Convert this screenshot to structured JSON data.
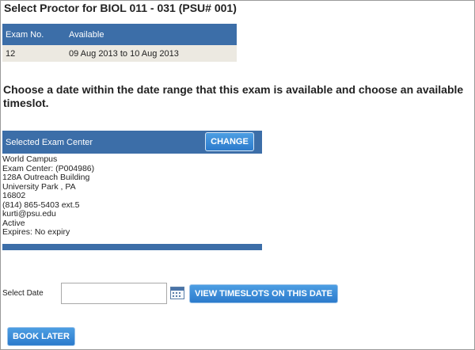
{
  "page": {
    "title": "Select Proctor for BIOL 011 - 031 (PSU# 001)"
  },
  "exam_table": {
    "headers": [
      "Exam No.",
      "Available"
    ],
    "rows": [
      [
        "12",
        "09 Aug 2013 to 10 Aug 2013"
      ]
    ]
  },
  "instruction": "Choose a date within the date range that this exam is available and choose an available timeslot.",
  "exam_center": {
    "header_label": "Selected Exam Center",
    "change_button": "CHANGE",
    "details": [
      "World Campus",
      "Exam Center: (P004986)",
      "128A Outreach Building",
      "University Park , PA",
      "16802",
      "(814) 865-5403 ext.5",
      "kurti@psu.edu",
      "Active",
      "Expires: No expiry"
    ]
  },
  "date_select": {
    "label": "Select Date",
    "value": "",
    "view_button": "VIEW TIMESLOTS ON THIS DATE"
  },
  "footer": {
    "book_later_button": "BOOK LATER"
  },
  "colors": {
    "header_blue": "#3c6ea8",
    "button_blue": "#2c7bcc",
    "row_bg": "#ece9e1"
  },
  "icons": {
    "calendar": "calendar-icon"
  }
}
